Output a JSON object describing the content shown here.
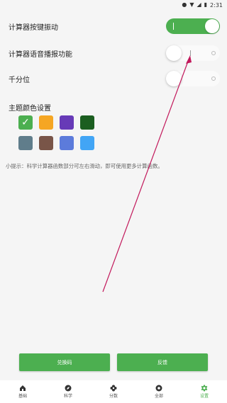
{
  "status_bar": {
    "time": "2:31",
    "icons": [
      "location-icon",
      "wifi-icon",
      "signal-icon",
      "battery-icon"
    ]
  },
  "settings": {
    "vibration_label": "计算器按键振动",
    "vibration_on": true,
    "voice_label": "计算器语音播报功能",
    "voice_on": false,
    "thousands_label": "千分位",
    "thousands_on": false
  },
  "theme": {
    "title": "主题颜色设置",
    "colors": [
      "#4caf50",
      "#f5a623",
      "#673ab7",
      "#1b5e20",
      "#607d8b",
      "#795548",
      "#5c7bdb",
      "#42a5f5"
    ],
    "selected_index": 0
  },
  "tip": "小提示：科学计算器函数部分可左右滑动，即可使用更多计算函数。",
  "buttons": {
    "left": "兑换码",
    "right": "反馈"
  },
  "nav": [
    {
      "label": "基础",
      "icon": "home-icon"
    },
    {
      "label": "科学",
      "icon": "compass-icon"
    },
    {
      "label": "分数",
      "icon": "flower-icon"
    },
    {
      "label": "全部",
      "icon": "grid-circle-icon"
    },
    {
      "label": "设置",
      "icon": "gear-icon"
    }
  ],
  "nav_active_index": 4,
  "colors": {
    "accent": "#4caf50",
    "arrow": "#c2185b"
  }
}
